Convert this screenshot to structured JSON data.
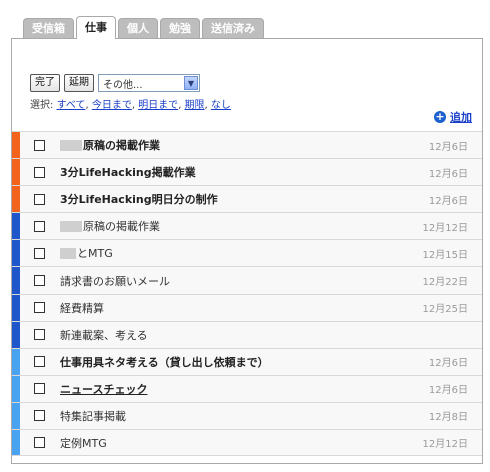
{
  "tabs": [
    {
      "label": "受信箱",
      "active": false
    },
    {
      "label": "仕事",
      "active": true
    },
    {
      "label": "個人",
      "active": false
    },
    {
      "label": "勉強",
      "active": false
    },
    {
      "label": "送信済み",
      "active": false
    }
  ],
  "controls": {
    "done_label": "完了",
    "postpone_label": "延期",
    "select_value": "その他..."
  },
  "filter": {
    "prefix": "選択:",
    "options": [
      "すべて",
      "今日まで",
      "明日まで",
      "期限",
      "なし"
    ]
  },
  "add_label": "追加",
  "colors": {
    "orange": "#f2641e",
    "dark_blue": "#1f56c9",
    "light_blue": "#4aa3f0"
  },
  "tasks": [
    {
      "title": "原稿の掲載作業",
      "date": "12月6日",
      "priority": "orange",
      "bold": true,
      "blurred": true
    },
    {
      "title": "3分LifeHacking掲載作業",
      "date": "12月6日",
      "priority": "orange",
      "bold": true,
      "blurred": false
    },
    {
      "title": "3分LifeHacking明日分の制作",
      "date": "12月6日",
      "priority": "orange",
      "bold": true,
      "blurred": false
    },
    {
      "title": "原稿の掲載作業",
      "date": "12月12日",
      "priority": "dark_blue",
      "bold": false,
      "blurred": true
    },
    {
      "title": "とMTG",
      "date": "12月15日",
      "priority": "dark_blue",
      "bold": false,
      "blurred": true
    },
    {
      "title": "請求書のお願いメール",
      "date": "12月22日",
      "priority": "dark_blue",
      "bold": false,
      "blurred": false
    },
    {
      "title": "経費精算",
      "date": "12月25日",
      "priority": "dark_blue",
      "bold": false,
      "blurred": false
    },
    {
      "title": "新連載案、考える",
      "date": "",
      "priority": "dark_blue",
      "bold": false,
      "blurred": false
    },
    {
      "title": "仕事用具ネタ考える（貸し出し依頼まで）",
      "date": "12月6日",
      "priority": "light_blue",
      "bold": true,
      "blurred": false
    },
    {
      "title": "ニュースチェック",
      "date": "12月6日",
      "priority": "light_blue",
      "bold": true,
      "blurred": false,
      "link": true
    },
    {
      "title": "特集記事掲載",
      "date": "12月8日",
      "priority": "light_blue",
      "bold": false,
      "blurred": false
    },
    {
      "title": "定例MTG",
      "date": "12月12日",
      "priority": "light_blue",
      "bold": false,
      "blurred": false
    }
  ]
}
